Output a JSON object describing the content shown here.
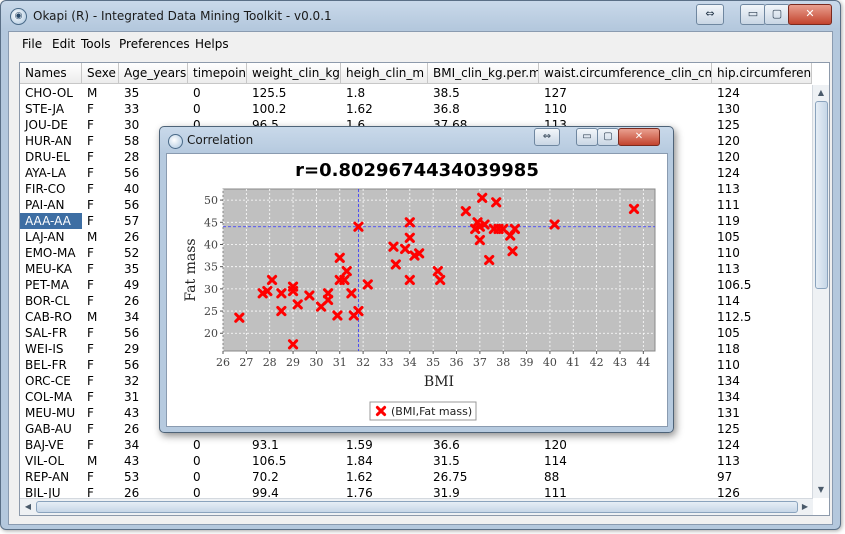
{
  "window": {
    "title": "Okapi (R) - Integrated Data Mining Toolkit - v0.0.1",
    "buttons": {
      "restore": "⇔",
      "minimize": "▭",
      "maximize": "▢",
      "close": "✕"
    }
  },
  "menu": [
    "File",
    "Edit",
    "Tools",
    "Preferences",
    "Helps"
  ],
  "table": {
    "columns": [
      "Names",
      "Sexe",
      "Age_years",
      "timepoint",
      "weight_clin_kg",
      "heigh_clin_m",
      "BMI_clin_kg.per.m",
      "waist.circumference_clin_cm",
      "hip.circumferenc"
    ],
    "selected_row": 8,
    "rows": [
      [
        "CHO-OL",
        "M",
        "35",
        "0",
        "125.5",
        "1.8",
        "38.5",
        "127",
        "124"
      ],
      [
        "STE-JA",
        "F",
        "33",
        "0",
        "100.2",
        "1.62",
        "36.8",
        "110",
        "130"
      ],
      [
        "JOU-DE",
        "F",
        "30",
        "0",
        "96.5",
        "1.6",
        "37.68",
        "113",
        "125"
      ],
      [
        "HUR-AN",
        "F",
        "58",
        "",
        "",
        "",
        "",
        "",
        "120"
      ],
      [
        "DRU-EL",
        "F",
        "28",
        "",
        "",
        "",
        "",
        "",
        "120"
      ],
      [
        "AYA-LA",
        "F",
        "56",
        "",
        "",
        "",
        "",
        "",
        "124"
      ],
      [
        "FIR-CO",
        "F",
        "40",
        "",
        "",
        "",
        "",
        "",
        "113"
      ],
      [
        "PAI-AN",
        "F",
        "56",
        "",
        "",
        "",
        "",
        "",
        "111"
      ],
      [
        "AAA-AA",
        "F",
        "57",
        "",
        "",
        "",
        "",
        "",
        "119"
      ],
      [
        "LAJ-AN",
        "M",
        "26",
        "",
        "",
        "",
        "",
        "",
        "105"
      ],
      [
        "EMO-MA",
        "F",
        "52",
        "",
        "",
        "",
        "",
        "",
        "110"
      ],
      [
        "MEU-KA",
        "F",
        "35",
        "",
        "",
        "",
        "",
        "",
        "113"
      ],
      [
        "PET-MA",
        "F",
        "49",
        "",
        "",
        "",
        "",
        "",
        "106.5"
      ],
      [
        "BOR-CL",
        "F",
        "26",
        "",
        "",
        "",
        "",
        "",
        "114"
      ],
      [
        "CAB-RO",
        "M",
        "34",
        "",
        "",
        "",
        "",
        "",
        "112.5"
      ],
      [
        "SAL-FR",
        "F",
        "56",
        "",
        "",
        "",
        "",
        "",
        "105"
      ],
      [
        "WEI-IS",
        "F",
        "29",
        "",
        "",
        "",
        "",
        "",
        "118"
      ],
      [
        "BEL-FR",
        "F",
        "56",
        "",
        "",
        "",
        "",
        "",
        "110"
      ],
      [
        "ORC-CE",
        "F",
        "32",
        "",
        "",
        "",
        "",
        "",
        "134"
      ],
      [
        "COL-MA",
        "F",
        "31",
        "",
        "",
        "",
        "",
        "",
        "134"
      ],
      [
        "MEU-MU",
        "F",
        "43",
        "",
        "",
        "",
        "",
        "",
        "131"
      ],
      [
        "GAB-AU",
        "F",
        "26",
        "",
        "",
        "",
        "",
        "",
        "125"
      ],
      [
        "BAJ-VE",
        "F",
        "34",
        "0",
        "93.1",
        "1.59",
        "36.6",
        "120",
        "124"
      ],
      [
        "VIL-OL",
        "M",
        "43",
        "0",
        "106.5",
        "1.84",
        "31.5",
        "114",
        "113"
      ],
      [
        "REP-AN",
        "F",
        "53",
        "0",
        "70.2",
        "1.62",
        "26.75",
        "88",
        "97"
      ],
      [
        "BIL-JU",
        "F",
        "26",
        "0",
        "99.4",
        "1.76",
        "31.9",
        "111",
        "126"
      ]
    ]
  },
  "dialog": {
    "title": "Correlation",
    "buttons": {
      "restore": "⇔",
      "minimize": "▭",
      "maximize": "▢",
      "close": "✕"
    }
  },
  "chart_data": {
    "type": "scatter",
    "title": "r=0.8029674434039985",
    "xlabel": "BMI",
    "ylabel": "Fat mass",
    "xlim": [
      26,
      44.5
    ],
    "ylim": [
      16,
      52.5
    ],
    "xticks": [
      26,
      27,
      28,
      29,
      30,
      31,
      32,
      33,
      34,
      35,
      36,
      37,
      38,
      39,
      40,
      41,
      42,
      43,
      44
    ],
    "yticks": [
      20,
      25,
      30,
      35,
      40,
      45,
      50
    ],
    "grid": true,
    "legend_position": "bottom",
    "crosshair": {
      "x": 31.8,
      "y": 44
    },
    "series": [
      {
        "name": "(BMI,Fat mass)",
        "color": "#ff0000",
        "marker": "x",
        "points": [
          [
            26.7,
            23.5
          ],
          [
            27.7,
            29
          ],
          [
            27.9,
            29.5
          ],
          [
            28.1,
            32
          ],
          [
            28.5,
            25
          ],
          [
            28.5,
            29
          ],
          [
            29.0,
            30.5
          ],
          [
            29.0,
            29.5
          ],
          [
            29.0,
            17.5
          ],
          [
            29.2,
            26.5
          ],
          [
            29.7,
            28.5
          ],
          [
            30.2,
            26
          ],
          [
            30.5,
            27.5
          ],
          [
            30.5,
            29
          ],
          [
            30.9,
            24
          ],
          [
            31.0,
            32
          ],
          [
            31.0,
            37
          ],
          [
            31.2,
            32
          ],
          [
            31.3,
            34
          ],
          [
            31.5,
            29
          ],
          [
            31.6,
            24
          ],
          [
            31.8,
            25
          ],
          [
            31.8,
            44
          ],
          [
            32.2,
            31
          ],
          [
            33.3,
            39.5
          ],
          [
            33.4,
            35.5
          ],
          [
            33.8,
            39
          ],
          [
            34.0,
            32
          ],
          [
            34.0,
            45
          ],
          [
            34.0,
            41.5
          ],
          [
            34.2,
            37.5
          ],
          [
            34.4,
            38
          ],
          [
            35.2,
            34
          ],
          [
            35.3,
            32
          ],
          [
            36.4,
            47.5
          ],
          [
            36.8,
            43.5
          ],
          [
            36.9,
            45
          ],
          [
            37.0,
            44
          ],
          [
            37.0,
            41
          ],
          [
            37.1,
            50.5
          ],
          [
            37.2,
            44.5
          ],
          [
            37.4,
            36.5
          ],
          [
            37.6,
            43.5
          ],
          [
            37.7,
            49.5
          ],
          [
            37.8,
            43.5
          ],
          [
            38.0,
            43.5
          ],
          [
            38.3,
            42
          ],
          [
            38.4,
            38.5
          ],
          [
            38.5,
            43.5
          ],
          [
            40.2,
            44.5
          ],
          [
            43.6,
            48
          ]
        ]
      }
    ]
  }
}
